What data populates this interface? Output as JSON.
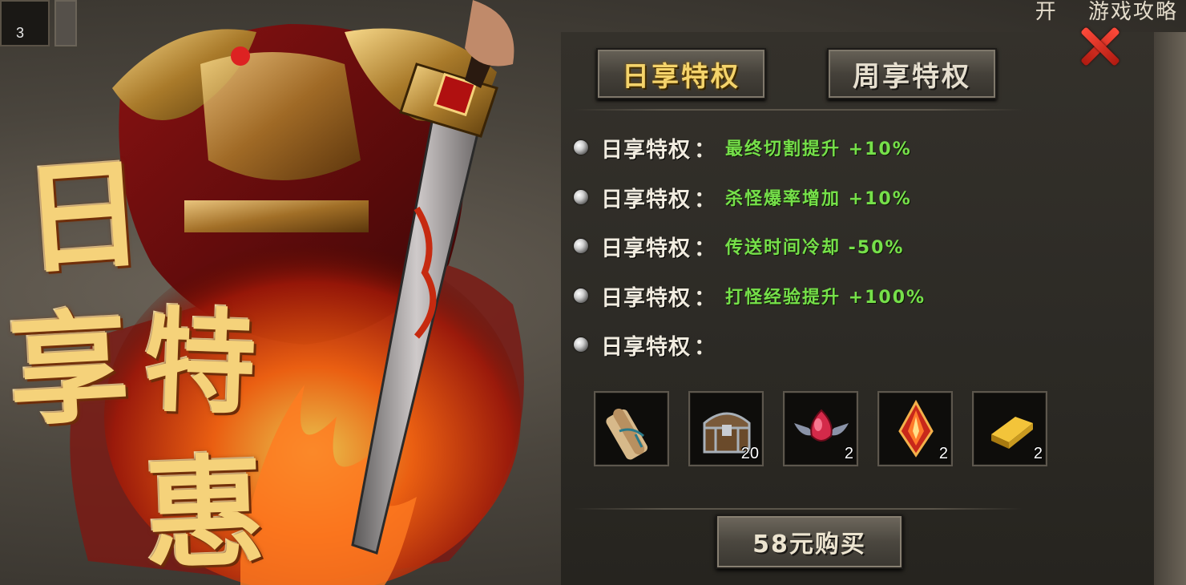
{
  "hud": {
    "slot_count": "3",
    "top_right_left": "开",
    "top_right_label": "游戏攻略"
  },
  "promo_art": {
    "char1": "日",
    "char2": "享",
    "char3": "特",
    "char4": "惠"
  },
  "tabs": [
    {
      "label": "日享特权",
      "active": true
    },
    {
      "label": "周享特权",
      "active": false
    }
  ],
  "perks": [
    {
      "label": "日享特权",
      "colon": "：",
      "desc": "最终切割提升 +10%"
    },
    {
      "label": "日享特权",
      "colon": "：",
      "desc": "杀怪爆率增加 +10%"
    },
    {
      "label": "日享特权",
      "colon": "：",
      "desc": "传送时间冷却 -50%"
    },
    {
      "label": "日享特权",
      "colon": "：",
      "desc": "打怪经验提升 +100%"
    },
    {
      "label": "日享特权",
      "colon": "：",
      "desc": ""
    }
  ],
  "rewards": [
    {
      "icon": "scroll-icon",
      "qty": ""
    },
    {
      "icon": "treasure-chest-icon",
      "qty": "20"
    },
    {
      "icon": "red-gem-icon",
      "qty": "2"
    },
    {
      "icon": "flame-crystal-icon",
      "qty": "2"
    },
    {
      "icon": "gold-bar-icon",
      "qty": "2"
    }
  ],
  "buy_button": {
    "label": "58元购买"
  },
  "colors": {
    "active_tab": "#f4d36b",
    "perk_desc": "#76e04a",
    "close": "#e0281a"
  }
}
